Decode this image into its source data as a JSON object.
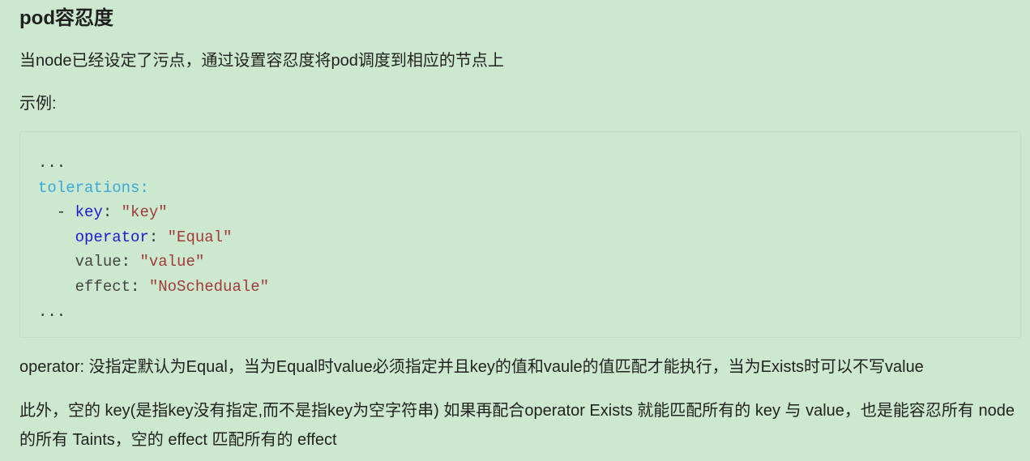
{
  "document": {
    "title": "pod容忍度",
    "intro": "当node已经设定了污点，通过设置容忍度将pod调度到相应的节点上",
    "example_label": "示例:",
    "code": {
      "line1": "...",
      "line2": "tolerations:",
      "line3_dash": "  - ",
      "line3_key": "key",
      "line3_colon": ": ",
      "line3_value": "\"key\"",
      "line4_indent": "    ",
      "line4_key": "operator",
      "line4_colon": ": ",
      "line4_value": "\"Equal\"",
      "line5_indent": "    ",
      "line5_key": "value",
      "line5_colon": ": ",
      "line5_value": "\"value\"",
      "line6_indent": "    ",
      "line6_key": "effect",
      "line6_colon": ": ",
      "line6_value": "\"NoScheduale\"",
      "line7": "..."
    },
    "operator_note": "operator: 没指定默认为Equal，当为Equal时value必须指定并且key的值和vaule的值匹配才能执行，当为Exists时可以不写value",
    "extra_note": "此外，空的 key(是指key没有指定,而不是指key为空字符串) 如果再配合operator Exists 就能匹配所有的 key 与 value，也是能容忍所有 node 的所有 Taints，空的 effect 匹配所有的 effect"
  },
  "colors": {
    "background": "#cce8cf",
    "text": "#222222",
    "yaml_section": "#3aa8d8",
    "yaml_key": "#1a1ad6",
    "yaml_string": "#a33a3a"
  }
}
